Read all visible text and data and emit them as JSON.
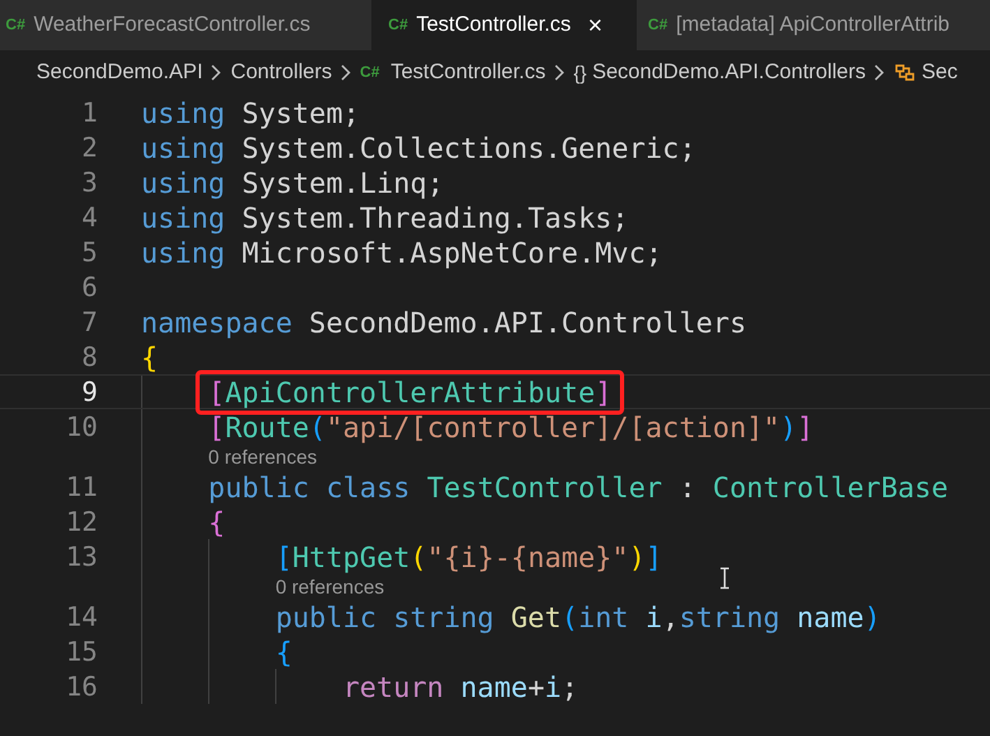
{
  "tabs": [
    {
      "icon": "C#",
      "label": "WeatherForecastController.cs",
      "selected": false
    },
    {
      "icon": "C#",
      "label": "TestController.cs",
      "selected": true,
      "close": "×"
    },
    {
      "icon": "C#",
      "label": "[metadata] ApiControllerAttrib",
      "selected": false
    }
  ],
  "breadcrumb": [
    {
      "kind": "folder",
      "label": "SecondDemo.API"
    },
    {
      "kind": "folder",
      "label": "Controllers"
    },
    {
      "kind": "file",
      "icon": "C#",
      "label": "TestController.cs"
    },
    {
      "kind": "namespace",
      "icon": "{}",
      "label": "SecondDemo.API.Controllers"
    },
    {
      "kind": "class",
      "label": "Sec"
    }
  ],
  "lines": [
    {
      "kind": "code",
      "number": "1",
      "current": false,
      "highlighted": false,
      "tokens": [
        {
          "kind": "keyword",
          "t": "using "
        },
        {
          "kind": "plain",
          "t": "System;"
        }
      ]
    },
    {
      "kind": "code",
      "number": "2",
      "current": false,
      "highlighted": false,
      "tokens": [
        {
          "kind": "keyword",
          "t": "using "
        },
        {
          "kind": "plain",
          "t": "System.Collections.Generic;"
        }
      ]
    },
    {
      "kind": "code",
      "number": "3",
      "current": false,
      "highlighted": false,
      "tokens": [
        {
          "kind": "keyword",
          "t": "using "
        },
        {
          "kind": "plain",
          "t": "System.Linq;"
        }
      ]
    },
    {
      "kind": "code",
      "number": "4",
      "current": false,
      "highlighted": false,
      "tokens": [
        {
          "kind": "keyword",
          "t": "using "
        },
        {
          "kind": "plain",
          "t": "System.Threading.Tasks;"
        }
      ]
    },
    {
      "kind": "code",
      "number": "5",
      "current": false,
      "highlighted": false,
      "tokens": [
        {
          "kind": "keyword",
          "t": "using "
        },
        {
          "kind": "plain",
          "t": "Microsoft.AspNetCore.Mvc;"
        }
      ]
    },
    {
      "kind": "code",
      "number": "6",
      "current": false,
      "highlighted": false
    },
    {
      "kind": "code",
      "number": "7",
      "current": false,
      "highlighted": false,
      "tokens": [
        {
          "kind": "keyword",
          "t": "namespace "
        },
        {
          "kind": "plain",
          "t": "SecondDemo.API.Controllers"
        }
      ]
    },
    {
      "kind": "code",
      "number": "8",
      "current": false,
      "highlighted": false,
      "tokens": [
        {
          "kind": "bracket1",
          "t": "{"
        }
      ]
    },
    {
      "kind": "code",
      "number": "9",
      "current": true,
      "highlighted": true,
      "tokens": [
        {
          "kind": "bracket2",
          "t": "    ["
        },
        {
          "kind": "type",
          "t": "ApiControllerAttribute"
        },
        {
          "kind": "bracket2",
          "t": "]"
        }
      ]
    },
    {
      "kind": "code",
      "number": "10",
      "current": false,
      "highlighted": false,
      "tokens": [
        {
          "kind": "bracket2",
          "t": "    ["
        },
        {
          "kind": "type",
          "t": "Route"
        },
        {
          "kind": "bracket3",
          "t": "("
        },
        {
          "kind": "string",
          "t": "\"api/[controller]/[action]\""
        },
        {
          "kind": "bracket3",
          "t": ")"
        },
        {
          "kind": "bracket2",
          "t": "]"
        }
      ]
    },
    {
      "kind": "lens",
      "text": "0 references"
    },
    {
      "kind": "code",
      "number": "11",
      "current": false,
      "highlighted": false,
      "tokens": [
        {
          "kind": "keyword",
          "t": "    public class "
        },
        {
          "kind": "type",
          "t": "TestController"
        },
        {
          "kind": "plain",
          "t": " : "
        },
        {
          "kind": "type",
          "t": "ControllerBase"
        }
      ]
    },
    {
      "kind": "code",
      "number": "12",
      "current": false,
      "highlighted": false,
      "tokens": [
        {
          "kind": "bracket2",
          "t": "    {"
        }
      ]
    },
    {
      "kind": "code",
      "number": "13",
      "current": false,
      "highlighted": false,
      "tokens": [
        {
          "kind": "bracket3",
          "t": "        ["
        },
        {
          "kind": "type",
          "t": "HttpGet"
        },
        {
          "kind": "bracket1",
          "t": "("
        },
        {
          "kind": "string",
          "t": "\"{i}-{name}\""
        },
        {
          "kind": "bracket1",
          "t": ")"
        },
        {
          "kind": "bracket3",
          "t": "]"
        }
      ]
    },
    {
      "kind": "lens",
      "text": "0 references"
    },
    {
      "kind": "code",
      "number": "14",
      "current": false,
      "highlighted": false,
      "tokens": [
        {
          "kind": "keyword",
          "t": "        public string "
        },
        {
          "kind": "function",
          "t": "Get"
        },
        {
          "kind": "bracket3",
          "t": "("
        },
        {
          "kind": "keyword",
          "t": "int "
        },
        {
          "kind": "param",
          "t": "i"
        },
        {
          "kind": "plain",
          "t": ","
        },
        {
          "kind": "keyword",
          "t": "string "
        },
        {
          "kind": "param",
          "t": "name"
        },
        {
          "kind": "bracket3",
          "t": ")"
        }
      ]
    },
    {
      "kind": "code",
      "number": "15",
      "current": false,
      "highlighted": false,
      "tokens": [
        {
          "kind": "bracket3",
          "t": "        {"
        }
      ]
    },
    {
      "kind": "code",
      "number": "16",
      "current": false,
      "highlighted": false,
      "tokens": [
        {
          "kind": "control",
          "t": "            return "
        },
        {
          "kind": "param",
          "t": "name"
        },
        {
          "kind": "plain",
          "t": "+"
        },
        {
          "kind": "param",
          "t": "i"
        },
        {
          "kind": "plain",
          "t": ";"
        }
      ]
    }
  ]
}
